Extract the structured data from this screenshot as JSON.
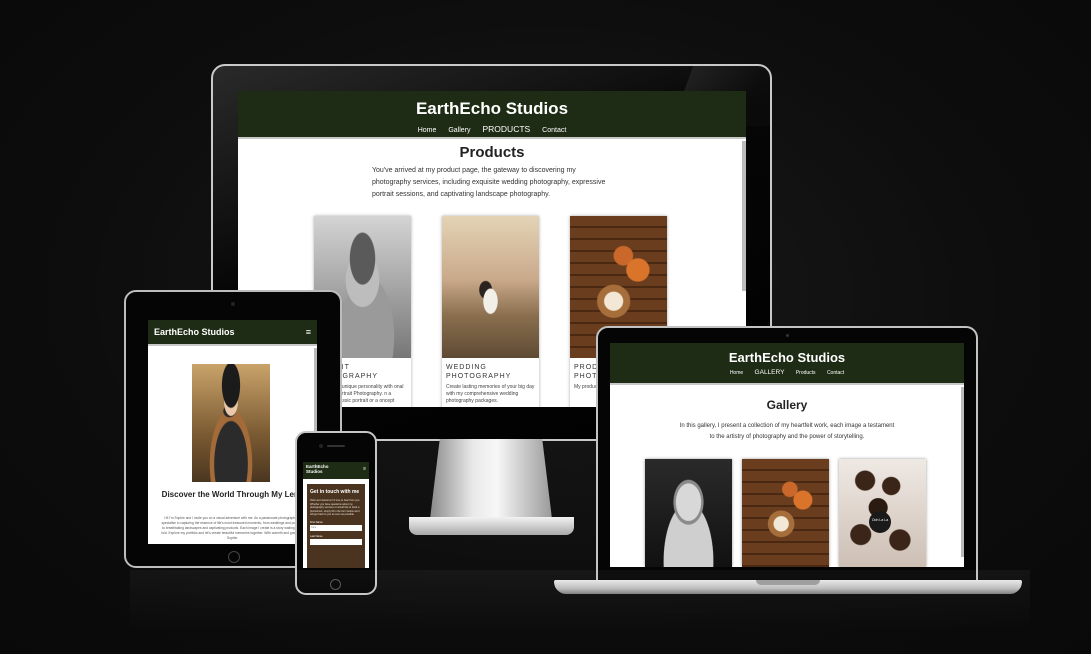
{
  "monitor": {
    "site_title": "EarthEcho Studios",
    "nav": [
      "Home",
      "Gallery",
      "PRODUCTS",
      "Contact"
    ],
    "heading": "Products",
    "intro": "You've arrived at my product page, the gateway to discovering my photography services, including exquisite wedding photography, expressive portrait sessions, and captivating landscape photography.",
    "cards": [
      {
        "caption_line1": "AIT",
        "caption_line2": "OGRAPHY",
        "desc": "ur unique personality with onal Portrait Photography. n a classic portrait or a oncept"
      },
      {
        "caption_line1": "WEDDING",
        "caption_line2": "PHOTOGRAPHY",
        "desc": "Create lasting memories of your big day with my comprehensive wedding photography packages."
      },
      {
        "caption_line1": "PRODU",
        "caption_line2": "PHOTO",
        "desc": "My produc warmth wi captivating"
      }
    ]
  },
  "tablet": {
    "site_title": "EarthEcho Studios",
    "menu_icon": "≡",
    "heading": "Discover the World Through My Lens",
    "para": "Hi! I'm Sophie and I invite you on a visual adventure with me. As a passionate photographer, I specialise in capturing the essence of life's most treasured moments, from weddings and portraits to breathtaking landscapes and captivating products. Each image I create is a story waiting to be told. Explore my portfolio and let's create beautiful memories together. With warmth and gratitude, Sophie."
  },
  "phone": {
    "site_title": "EarthEcho Studios",
    "menu_icon": "≡",
    "form_title": "Get in touch with me",
    "form_text": "Hello and welcome! I'd love to hear from you. Whether you have questions about my photography services or would like to book a photoshoot, simply fill in the form below and I will get back to you as soon as possible.",
    "first_label": "First Name",
    "first_placeholder": "Jane",
    "last_label": "Last Name"
  },
  "laptop": {
    "site_title": "EarthEcho Studios",
    "nav": [
      "Home",
      "GALLERY",
      "Products",
      "Contact"
    ],
    "heading": "Gallery",
    "intro": "In this gallery, I present a collection of my heartfelt work, each image a testament to the artistry of photography and the power of storytelling.",
    "photo_badge": "Ooh La La"
  },
  "colors": {
    "header_bg": "#1f2c15",
    "form_bg": "#4a3420",
    "page_bg": "#0d0d0d"
  }
}
